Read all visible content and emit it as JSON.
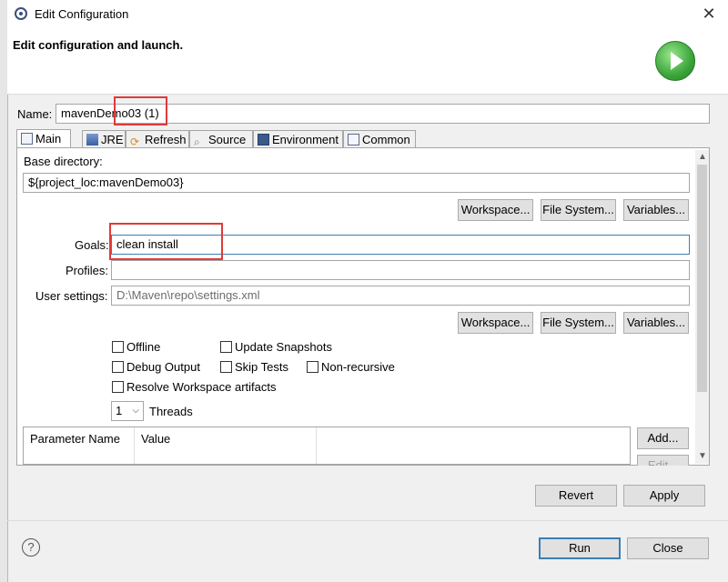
{
  "window": {
    "title": "Edit Configuration",
    "header_title": "Edit configuration and launch."
  },
  "config": {
    "name_label": "Name:",
    "name_value": "mavenDemo03 (1)"
  },
  "tabs": [
    {
      "label": "Main",
      "icon": "main-tab-icon"
    },
    {
      "label": "JRE",
      "icon": "jre-icon"
    },
    {
      "label": "Refresh",
      "icon": "refresh-icon"
    },
    {
      "label": "Source",
      "icon": "source-icon"
    },
    {
      "label": "Environment",
      "icon": "environment-icon"
    },
    {
      "label": "Common",
      "icon": "common-icon"
    }
  ],
  "main": {
    "base_dir_label": "Base directory:",
    "base_dir_value": "${project_loc:mavenDemo03}",
    "workspace_label": "Workspace...",
    "filesystem_label": "File System...",
    "variables_label": "Variables...",
    "goals_label": "Goals:",
    "goals_value": "clean  install",
    "profiles_label": "Profiles:",
    "profiles_value": "",
    "user_settings_label": "User settings:",
    "user_settings_value": "D:\\Maven\\repo\\settings.xml",
    "offline_label": "Offline",
    "update_snapshots_label": "Update Snapshots",
    "debug_output_label": "Debug Output",
    "skip_tests_label": "Skip Tests",
    "non_recursive_label": "Non-recursive",
    "resolve_workspace_label": "Resolve Workspace artifacts",
    "threads_value": "1",
    "threads_label": "Threads",
    "param_name_header": "Parameter Name",
    "value_header": "Value",
    "add_label": "Add...",
    "edit_label": "Edit..."
  },
  "footer": {
    "revert_label": "Revert",
    "apply_label": "Apply",
    "run_label": "Run",
    "close_label": "Close",
    "help_glyph": "?"
  }
}
